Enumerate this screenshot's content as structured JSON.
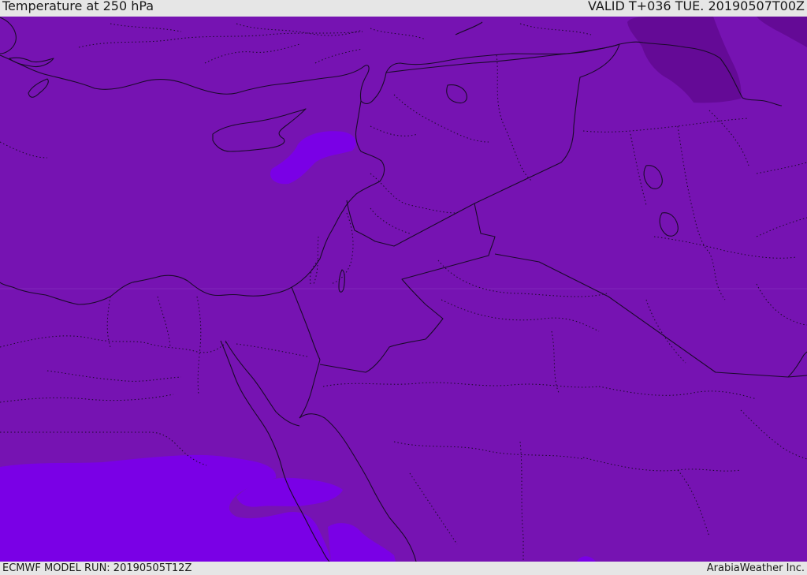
{
  "header": {
    "title": "Temperature at 250 hPa",
    "valid": "VALID T+036 TUE. 20190507T00Z"
  },
  "footer": {
    "model_run": "ECMWF MODEL RUN: 20190505T12Z",
    "credit": "ArabiaWeather Inc."
  },
  "map": {
    "colors": {
      "base_fill": "#7613b2",
      "warm_patch": "#7a00e6",
      "cold_patch": "#640a96",
      "coast_line": "#1a0a2a",
      "border_line": "#1a0a2a"
    }
  }
}
